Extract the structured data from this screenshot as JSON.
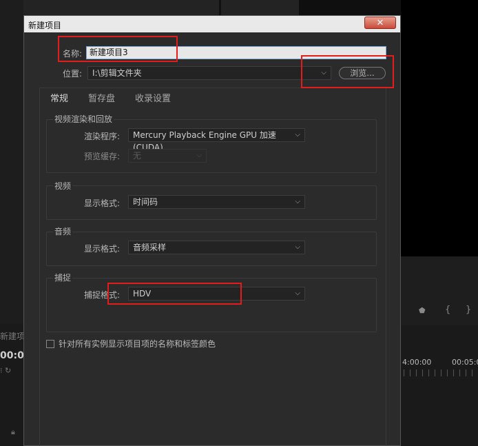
{
  "background": {
    "project_label": "新建项",
    "timecode": "00:0",
    "timeline_tc1": "4:00:00",
    "timeline_tc2": "00:05:0"
  },
  "dialog": {
    "title": "新建项目",
    "close_symbol": "✕",
    "name_label": "名称:",
    "name_value": "新建项目3",
    "location_label": "位置:",
    "location_value": "I:\\剪辑文件夹",
    "browse_label": "浏览...",
    "tabs": [
      {
        "label": "常规",
        "active": true
      },
      {
        "label": "暂存盘",
        "active": false
      },
      {
        "label": "收录设置",
        "active": false
      }
    ],
    "groups": {
      "render": {
        "title": "视频渲染和回放",
        "renderer_label": "渲染程序:",
        "renderer_value": "Mercury Playback Engine GPU 加速 (CUDA)",
        "preview_cache_label": "预览缓存:",
        "preview_cache_value": "无"
      },
      "video": {
        "title": "视频",
        "display_format_label": "显示格式:",
        "display_format_value": "时间码"
      },
      "audio": {
        "title": "音频",
        "display_format_label": "显示格式:",
        "display_format_value": "音频采样"
      },
      "capture": {
        "title": "捕捉",
        "capture_format_label": "捕捉格式:",
        "capture_format_value": "HDV"
      }
    },
    "checkbox_label": "针对所有实例显示项目项的名称和标签颜色",
    "checkbox_checked": false
  },
  "colors": {
    "highlight": "#e51c1c",
    "dialog_bg": "#2b2b2b"
  }
}
